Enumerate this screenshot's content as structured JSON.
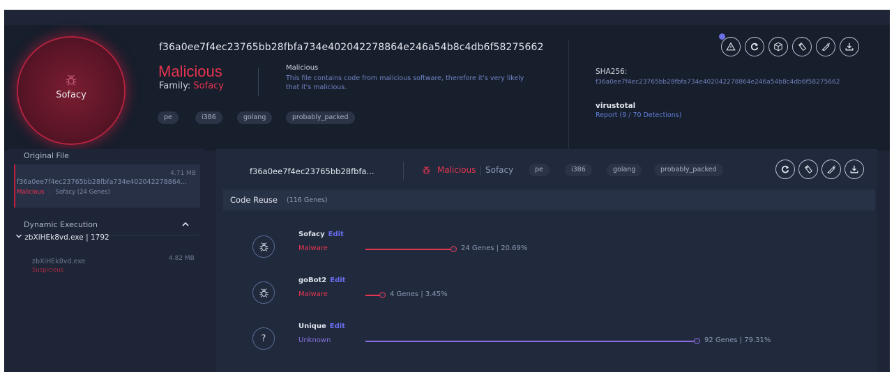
{
  "header": {
    "verdict_circle": {
      "family": "Sofacy"
    },
    "hash": "f36a0ee7f4ec23765bb28fbfa734e402042278864e246a54b8c4db6f58275662",
    "verdict": "Malicious",
    "family_label": "Family:",
    "family_value": "Sofacy",
    "verdict_detail_title": "Malicious",
    "verdict_detail_desc": "This file contains code from malicious software, therefore it's very likely that it's malicious.",
    "tags": [
      "pe",
      "i386",
      "golang",
      "probably_packed"
    ],
    "sha_label": "SHA256:",
    "sha_value": "f36a0ee7f4ec23765bb28fbfa734e402042278864e246a54b8c4db6f58275662",
    "vt_label": "virustotal",
    "vt_link": "Report (9 / 70 Detections)",
    "action_icons": [
      "warning-icon",
      "refresh-icon",
      "package-icon",
      "tag-icon",
      "syringe-icon",
      "download-icon"
    ]
  },
  "sidebar": {
    "original_title": "Original File",
    "original_file": {
      "size": "4.71 MB",
      "hash": "f36a0ee7f4ec23765bb28fbfa734e402042278864...",
      "verdict": "Malicious",
      "genes": "Sofacy (24 Genes)"
    },
    "dynamic_title": "Dynamic Execution",
    "process": "zbXiHEk8vd.exe | 1792",
    "child": {
      "name": "zbXiHEk8vd.exe",
      "size": "4.82 MB",
      "status": "Suspicious"
    }
  },
  "main": {
    "hash_short": "f36a0ee7f4ec23765bb28fbfa...",
    "verdict": "Malicious",
    "family": "Sofacy",
    "tags": [
      "pe",
      "i386",
      "golang",
      "probably_packed"
    ],
    "code_reuse_title": "Code Reuse",
    "code_reuse_count": "(116 Genes)",
    "genes": [
      {
        "name": "Sofacy",
        "edit": "Edit",
        "type": "Malware",
        "count": "24 Genes | 20.69%",
        "percent": 20.69,
        "icon": "bug-icon",
        "color": "#e8344f"
      },
      {
        "name": "goBot2",
        "edit": "Edit",
        "type": "Malware",
        "count": "4 Genes | 3.45%",
        "percent": 3.45,
        "icon": "bug-icon",
        "color": "#e8344f"
      },
      {
        "name": "Unique",
        "edit": "Edit",
        "type": "Unknown",
        "count": "92 Genes | 79.31%",
        "percent": 79.31,
        "icon": "question-icon",
        "color": "#8b6fe0"
      }
    ]
  }
}
